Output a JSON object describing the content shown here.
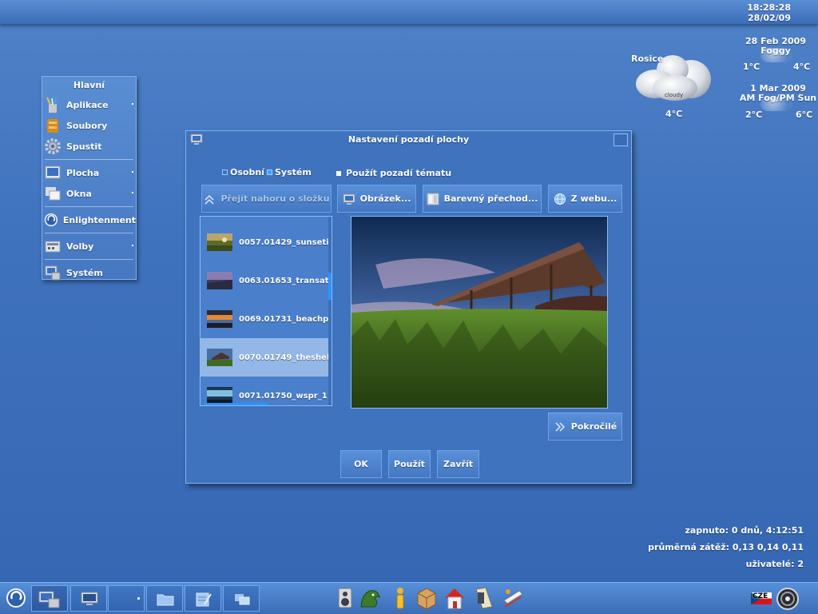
{
  "clock": {
    "time": "18:28:28",
    "date": "28/02/09"
  },
  "weather": {
    "city": "Rosice",
    "current_temp": "4°C",
    "icon_label": "cloudy",
    "forecast": [
      {
        "date": "28 Feb 2009",
        "condition": "Foggy",
        "low": "1°C",
        "high": "4°C"
      },
      {
        "date": "1 Mar 2009",
        "condition": "AM Fog/PM Sun",
        "low": "2°C",
        "high": "6°C"
      }
    ]
  },
  "menu": {
    "title": "Hlavní",
    "items": [
      {
        "label": "Aplikace",
        "icon": "brushes-icon"
      },
      {
        "label": "Soubory",
        "icon": "files-icon"
      },
      {
        "label": "Spustit",
        "icon": "gear-icon"
      },
      {
        "label": "Plocha",
        "icon": "desktop-icon"
      },
      {
        "label": "Okna",
        "icon": "windows-icon"
      },
      {
        "label": "Enlightenment",
        "icon": "enlightenment-icon"
      },
      {
        "label": "Volby",
        "icon": "settings-icon"
      },
      {
        "label": "Systém",
        "icon": "system-icon"
      }
    ]
  },
  "dialog": {
    "title": "Nastavení pozadí plochy",
    "radio_personal": "Osobní",
    "radio_system": "Systém",
    "use_theme": "Použít pozadí tématu",
    "btn_up": "Přejít nahoru o složku",
    "btn_picture": "Obrázek...",
    "btn_gradient": "Barevný přechod...",
    "btn_web": "Z webu...",
    "btn_advanced": "Pokročilé",
    "btn_ok": "OK",
    "btn_apply": "Použít",
    "btn_close": "Zavřít",
    "files": [
      "0057.01429_sunseti",
      "0063.01653_transat",
      "0069.01731_beachp",
      "0070.01749_theshel",
      "0071.01750_wspr_1"
    ]
  },
  "stats": {
    "uptime": "zapnuto: 0 dnů, 4:12:51",
    "load": "průměrná zátěž: 0,13 0,14 0,11",
    "users": "uživatelé: 2"
  },
  "keyboard_layout": "CZE"
}
